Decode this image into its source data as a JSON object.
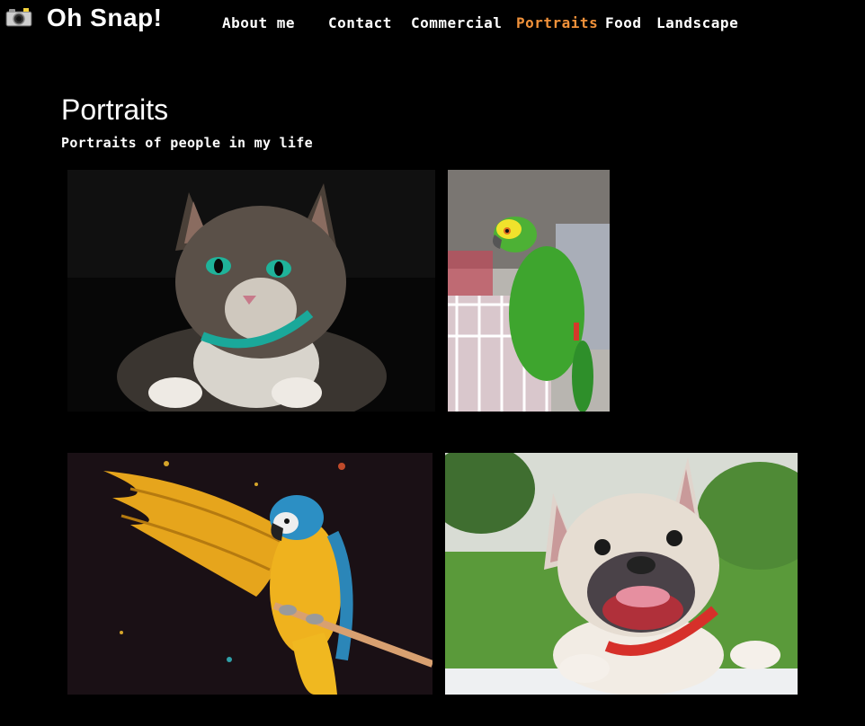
{
  "brand": {
    "name": "Oh Snap!",
    "icon": "camera-icon"
  },
  "nav": [
    {
      "label": "About me",
      "active": false
    },
    {
      "label": "Contact",
      "active": false
    },
    {
      "label": "Commercial",
      "active": false
    },
    {
      "label": "Portraits",
      "active": true
    },
    {
      "label": "Food",
      "active": false
    },
    {
      "label": "Landscape",
      "active": false
    }
  ],
  "colors": {
    "background": "#000000",
    "text": "#ffffff",
    "active_link": "#f0913a"
  },
  "page": {
    "title": "Portraits",
    "subtitle": "Portraits of people in my life"
  },
  "photos": [
    {
      "subject": "tabby cat with green eyes"
    },
    {
      "subject": "green parrot on a cage"
    },
    {
      "subject": "blue and gold macaw with spread wings"
    },
    {
      "subject": "french bulldog with red collar"
    }
  ]
}
